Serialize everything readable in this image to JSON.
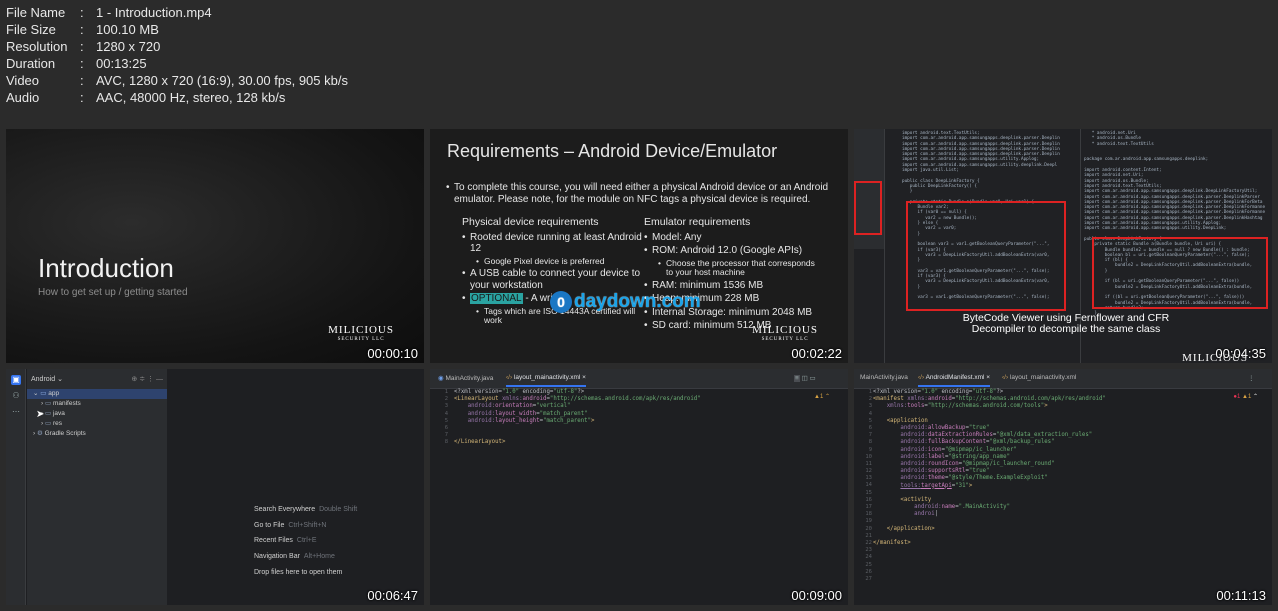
{
  "meta": {
    "file_name_label": "File Name",
    "file_name": "1 - Introduction.mp4",
    "file_size_label": "File Size",
    "file_size": "100.10 MB",
    "resolution_label": "Resolution",
    "resolution": "1280 x 720",
    "duration_label": "Duration",
    "duration": "00:13:25",
    "video_label": "Video",
    "video": "AVC, 1280 x 720 (16:9), 30.00 fps, 905 kb/s",
    "audio_label": "Audio",
    "audio": "AAC, 48000 Hz, stereo, 128 kb/s",
    "separator": ":"
  },
  "brand": {
    "logo": "MILICIOUS",
    "logo_sub": "SECURITY LLC"
  },
  "watermark": {
    "disc": "0",
    "text": "daydown.com"
  },
  "thumbs": [
    {
      "time": "00:00:10",
      "title": "Introduction",
      "subtitle": "How to get set up / getting started"
    },
    {
      "time": "00:02:22",
      "title": "Requirements – Android Device/Emulator",
      "intro": "To complete this course, you will need either a physical Android device or an Android emulator. Please note, for the module on NFC tags a physical device is required.",
      "col1_title": "Physical device requirements",
      "col1_a": "Rooted device running at least Android 12",
      "col1_a_sub": "Google Pixel device is preferred",
      "col1_b": "A USB cable to connect your device to your workstation",
      "col1_c_hl": "OPTIONAL",
      "col1_c": " - A writ",
      "col1_c_sub": "Tags which are ISO 14443A certified will work",
      "col2_title": "Emulator requirements",
      "col2_a": "Model: Any",
      "col2_b": "ROM: Android 12.0 (Google APIs)",
      "col2_b_sub": "Choose the processor that corresponds to your host machine",
      "col2_c": "RAM: minimum 1536 MB",
      "col2_d": "Heap: minimum 228 MB",
      "col2_e": "Internal Storage: minimum 2048 MB",
      "col2_f": "SD card: minimum 512 MB"
    },
    {
      "time": "00:04:35",
      "caption": "ByteCode Viewer using Fernflower and CFR Decompiler to decompile the same class"
    },
    {
      "time": "00:06:47",
      "project_title": "Android",
      "tree": [
        "app",
        "manifests",
        "java",
        "res",
        "Gradle Scripts"
      ],
      "hints": [
        {
          "label": "Search Everywhere",
          "key": "Double Shift"
        },
        {
          "label": "Go to File",
          "key": "Ctrl+Shift+N"
        },
        {
          "label": "Recent Files",
          "key": "Ctrl+E"
        },
        {
          "label": "Navigation Bar",
          "key": "Alt+Home"
        },
        {
          "label": "Drop files here to open them",
          "key": ""
        }
      ]
    },
    {
      "time": "00:09:00",
      "tab1": "MainActivity.java",
      "tab2": "layout_mainactivity.xml"
    },
    {
      "time": "00:11:13",
      "tab1": "MainActivity.java",
      "tab2": "AndroidManifest.xml",
      "tab3": "layout_mainactivity.xml",
      "warn": "1"
    }
  ]
}
